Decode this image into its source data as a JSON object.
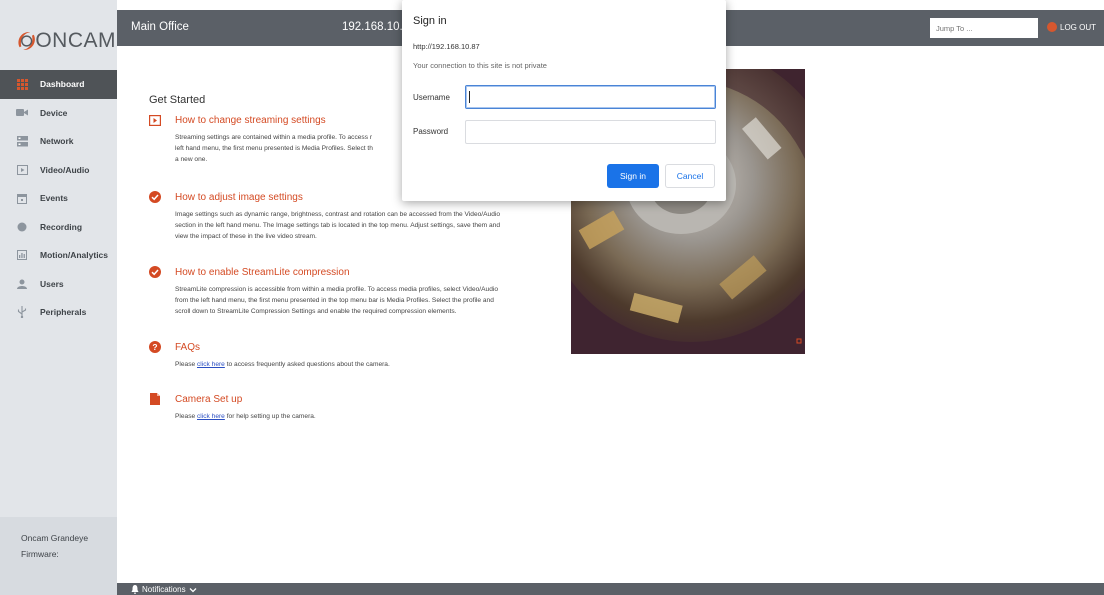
{
  "brand": {
    "logo_text": "ONCAM",
    "accent": "#d6572e"
  },
  "sidebar": {
    "items": [
      {
        "label": "Dashboard",
        "icon": "dashboard-grid-icon",
        "active": true
      },
      {
        "label": "Device",
        "icon": "camera-icon"
      },
      {
        "label": "Network",
        "icon": "network-icon"
      },
      {
        "label": "Video/Audio",
        "icon": "video-icon"
      },
      {
        "label": "Events",
        "icon": "calendar-icon"
      },
      {
        "label": "Recording",
        "icon": "record-icon"
      },
      {
        "label": "Motion/Analytics",
        "icon": "analytics-icon"
      },
      {
        "label": "Users",
        "icon": "user-icon"
      },
      {
        "label": "Peripherals",
        "icon": "usb-icon"
      }
    ],
    "footer": {
      "title": "Oncam Grandeye",
      "firmware_label": "Firmware:"
    }
  },
  "header": {
    "title": "Main Office",
    "ip": "192.168.10.8",
    "jump_placeholder": "Jump To ...",
    "logout_label": "LOG OUT"
  },
  "main": {
    "get_started_title": "Get Started",
    "topics": [
      {
        "title": "How to change streaming settings",
        "icon": "play-icon",
        "lines": [
          "Streaming settings are contained within a media profile. To access r",
          "left hand menu, the first menu presented is Media Profiles. Select th",
          "a new one."
        ]
      },
      {
        "title": "How to adjust image settings",
        "icon": "check-circle-icon",
        "lines": [
          "Image settings such as dynamic range, brightness, contrast and rotation can be accessed from the Video/Audio",
          "section in the left hand menu. The Image settings tab is located in the top menu. Adjust settings, save them and",
          "view the impact of these in the live video stream."
        ]
      },
      {
        "title": "How to enable StreamLite compression",
        "icon": "check-circle-icon",
        "lines": [
          "StreamLite compression is accessible from within a media profile. To access media profiles, select Video/Audio",
          "from the left hand menu, the first menu presented in the top menu bar is Media Profiles. Select the profile and",
          "scroll down to StreamLite Compression Settings and enable the required compression elements."
        ]
      },
      {
        "title": "FAQs",
        "icon": "question-circle-icon",
        "prefix": "Please ",
        "link": "click here",
        "suffix": " to access frequently asked questions about the camera."
      },
      {
        "title": "Camera Set up",
        "icon": "document-icon",
        "prefix": "Please ",
        "link": "click here",
        "suffix": " for help setting up the camera."
      }
    ]
  },
  "footer": {
    "notifications_label": "Notifications"
  },
  "dialog": {
    "title": "Sign in",
    "url": "http://192.168.10.87",
    "warning": "Your connection to this site is not private",
    "username_label": "Username",
    "password_label": "Password",
    "username_value": "",
    "password_value": "",
    "signin_label": "Sign in",
    "cancel_label": "Cancel"
  }
}
